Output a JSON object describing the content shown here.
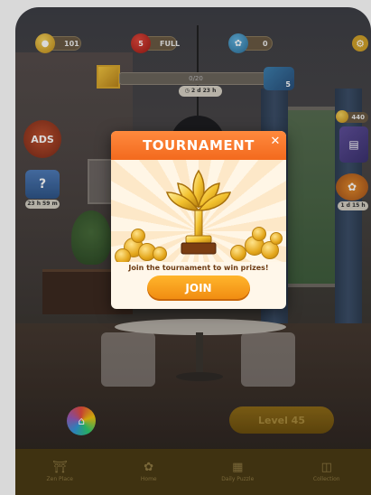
{
  "top_bar": {
    "coins": "101",
    "lives_count": "5",
    "lives_status": "FULL",
    "lotus_count": "0"
  },
  "progress": {
    "label": "0/20",
    "fraction": 0,
    "timer": "2 d 23 h",
    "reward_count": "5"
  },
  "side_left": {
    "ads_label": "ADS",
    "mystery_timer": "23 h 59 m"
  },
  "side_right": {
    "coins": "440",
    "event_timer": "1 d 15 h"
  },
  "level_button": "Level 45",
  "nav": {
    "items": [
      {
        "label": "Zen Place",
        "icon": "pagoda-icon"
      },
      {
        "label": "Home",
        "icon": "lotus-icon"
      },
      {
        "label": "Daily Puzzle",
        "icon": "calendar-icon"
      },
      {
        "label": "Collection",
        "icon": "book-icon"
      }
    ]
  },
  "modal": {
    "title": "TOURNAMENT",
    "close": "✕",
    "message": "Join the tournament to win prizes!",
    "join_label": "JOIN"
  }
}
